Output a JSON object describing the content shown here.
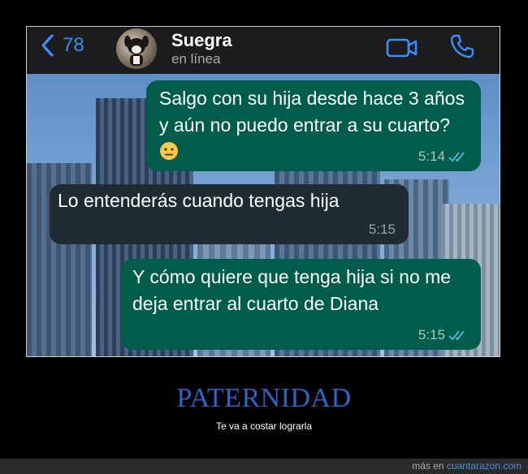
{
  "header": {
    "back_count": "78",
    "contact_name": "Suegra",
    "status": "en línea"
  },
  "messages": [
    {
      "direction": "outgoing",
      "text": "Salgo con su hija desde hace 3 años y aún no puedo entrar a su cuarto?",
      "emoji": "neutral-face",
      "time": "5:14",
      "read": true
    },
    {
      "direction": "incoming",
      "text": "Lo entenderás cuando tengas hija",
      "time": "5:15"
    },
    {
      "direction": "outgoing",
      "text": "Y cómo quiere que tenga hija si no me deja entrar al cuarto de Diana",
      "time": "5:15",
      "read": true
    }
  ],
  "caption": {
    "title": "PATERNIDAD",
    "subtitle": "Te va a costar lograrla"
  },
  "footer": {
    "prefix": "más en",
    "site": "cuantarazon.com"
  },
  "colors": {
    "accent": "#3a8ef6",
    "outgoing_bubble": "#005c4b",
    "incoming_bubble": "#1f2c33",
    "caption_title": "#2f63c5"
  }
}
